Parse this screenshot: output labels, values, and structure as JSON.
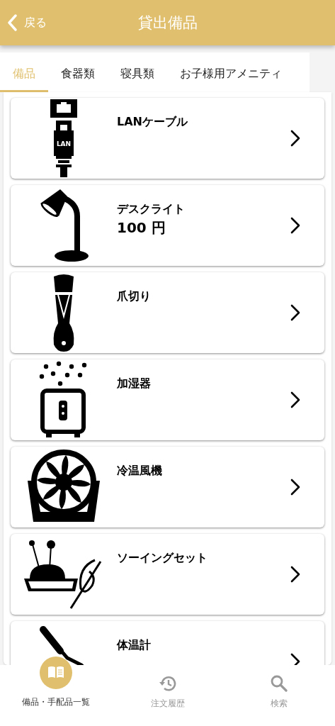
{
  "header": {
    "back_label": "戻る",
    "title": "貸出備品"
  },
  "tabs": [
    {
      "label": "備品",
      "selected": true
    },
    {
      "label": "食器類",
      "selected": false
    },
    {
      "label": "寝具類",
      "selected": false
    },
    {
      "label": "お子様用アメニティ",
      "selected": false
    }
  ],
  "items": [
    {
      "kind": "lan",
      "icon_text": "LAN",
      "name": "LANケーブル"
    },
    {
      "kind": "lamp",
      "name": "デスクライト",
      "price": "100 円"
    },
    {
      "kind": "clipper",
      "name": "爪切り"
    },
    {
      "kind": "humidifier",
      "name": "加湿器"
    },
    {
      "kind": "fan",
      "name": "冷温風機"
    },
    {
      "kind": "sewing",
      "name": "ソーイングセット"
    },
    {
      "kind": "thermometer",
      "name": "体温計"
    }
  ],
  "bottom_nav": [
    {
      "kind": "book",
      "label": "備品・手配品一覧",
      "selected": true
    },
    {
      "kind": "history",
      "label": "注文履歴",
      "selected": false
    },
    {
      "kind": "search",
      "label": "検索",
      "selected": false
    }
  ]
}
